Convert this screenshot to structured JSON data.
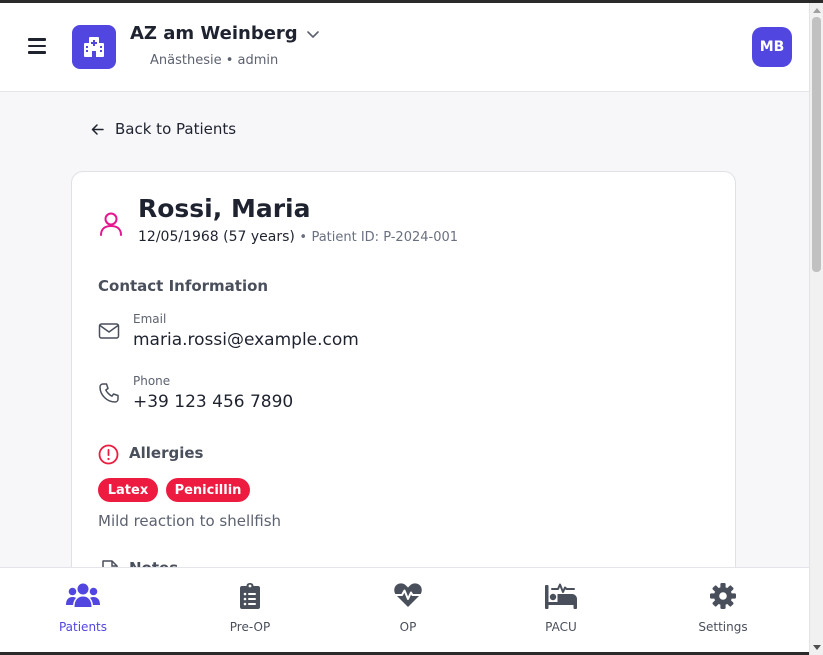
{
  "header": {
    "hospital_name": "AZ am Weinberg",
    "subtitle": "Anästhesie • admin",
    "avatar_initials": "MB",
    "accent_color": "#5147e0"
  },
  "navigation": {
    "back_label": "Back to Patients"
  },
  "patient": {
    "name": "Rossi, Maria",
    "dob_age": "12/05/1968 (57 years)",
    "separator": "•",
    "patient_id": "Patient ID: P-2024-001"
  },
  "contact": {
    "title": "Contact Information",
    "email_label": "Email",
    "email_value": "maria.rossi@example.com",
    "phone_label": "Phone",
    "phone_value": "+39 123 456 7890"
  },
  "allergies": {
    "title": "Allergies",
    "items": [
      "Latex",
      "Penicillin"
    ],
    "note": "Mild reaction to shellfish",
    "badge_color": "#ec1b3f"
  },
  "notes": {
    "title": "Notes"
  },
  "bottom_nav": {
    "items": [
      {
        "label": "Patients",
        "icon": "users-icon",
        "active": true
      },
      {
        "label": "Pre-OP",
        "icon": "clipboard-list-icon",
        "active": false
      },
      {
        "label": "OP",
        "icon": "heart-pulse-icon",
        "active": false
      },
      {
        "label": "PACU",
        "icon": "bed-pulse-icon",
        "active": false
      },
      {
        "label": "Settings",
        "icon": "gear-icon",
        "active": false
      }
    ]
  }
}
